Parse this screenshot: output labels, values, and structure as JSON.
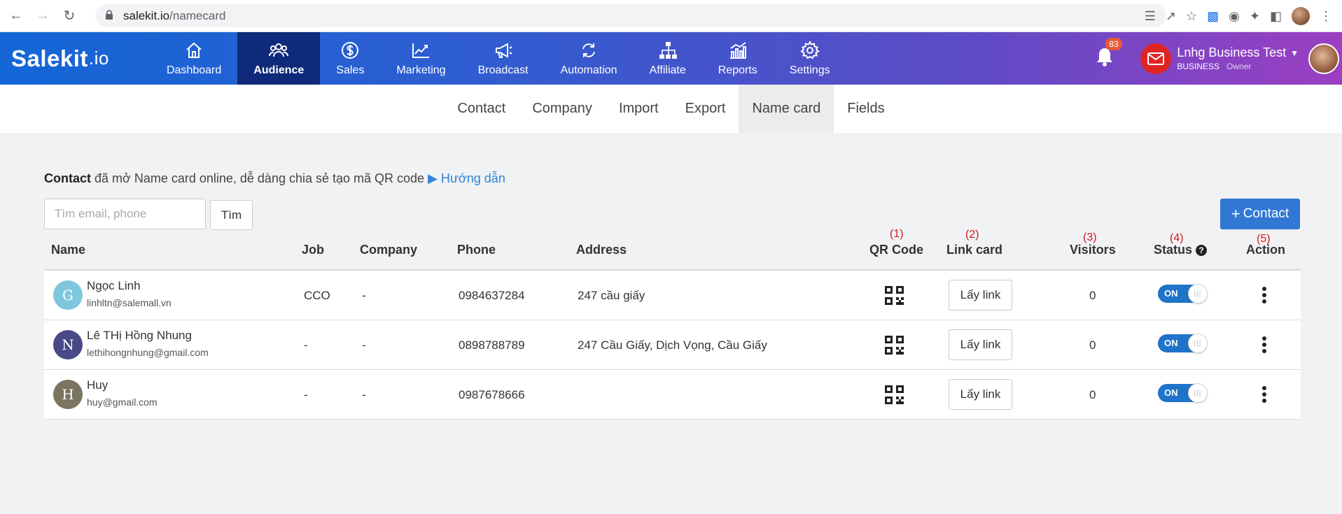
{
  "browser": {
    "url_host": "salekit.io",
    "url_path": "/namecard"
  },
  "app": {
    "logo_main": "Salekit",
    "logo_suffix": ".io",
    "nav": [
      {
        "label": "Dashboard",
        "icon": "home-icon"
      },
      {
        "label": "Audience",
        "icon": "users-icon",
        "active": true
      },
      {
        "label": "Sales",
        "icon": "dollar-icon"
      },
      {
        "label": "Marketing",
        "icon": "trend-chart-icon"
      },
      {
        "label": "Broadcast",
        "icon": "megaphone-icon"
      },
      {
        "label": "Automation",
        "icon": "cycle-icon"
      },
      {
        "label": "Affiliate",
        "icon": "network-icon"
      },
      {
        "label": "Reports",
        "icon": "bar-chart-icon"
      },
      {
        "label": "Settings",
        "icon": "gear-icon"
      }
    ],
    "notification_count": "83",
    "user": {
      "name": "Lnhg Business Test",
      "plan": "BUSINESS",
      "role": "Owner"
    }
  },
  "subnav": {
    "tabs": [
      "Contact",
      "Company",
      "Import",
      "Export",
      "Name card",
      "Fields"
    ],
    "active": "Name card"
  },
  "intro": {
    "bold": "Contact",
    "text": " đã mở Name card online, dễ dàng chia sẻ tạo mã QR code ",
    "guide": "Hướng dẫn"
  },
  "search": {
    "placeholder": "Tìm email, phone",
    "button": "Tìm"
  },
  "add_button": "Contact",
  "annotations": [
    "(1)",
    "(2)",
    "(3)",
    "(4)",
    "(5)"
  ],
  "table": {
    "headers": {
      "name": "Name",
      "job": "Job",
      "company": "Company",
      "phone": "Phone",
      "address": "Address",
      "qr": "QR Code",
      "link": "Link card",
      "visitors": "Visitors",
      "status": "Status",
      "action": "Action"
    },
    "link_label": "Lấy link",
    "toggle_label": "ON",
    "rows": [
      {
        "initial": "G",
        "avatar_color": "#7ec7dc",
        "name": "Ngọc Linh",
        "email": "linhltn@salemall.vn",
        "job": "CCO",
        "company": "-",
        "phone": "0984637284",
        "address": "247 cầu giấy",
        "visitors": "0"
      },
      {
        "initial": "N",
        "avatar_color": "#474a87",
        "name": "Lê THị Hồng Nhung",
        "email": "lethihongnhung@gmail.com",
        "job": "-",
        "company": "-",
        "phone": "0898788789",
        "address": "247 Cầu Giấy, Dịch Vọng, Cầu Giấy",
        "visitors": "0"
      },
      {
        "initial": "H",
        "avatar_color": "#7a7461",
        "name": "Huy",
        "email": "huy@gmail.com",
        "job": "-",
        "company": "-",
        "phone": "0987678666",
        "address": "",
        "visitors": "0"
      }
    ]
  }
}
